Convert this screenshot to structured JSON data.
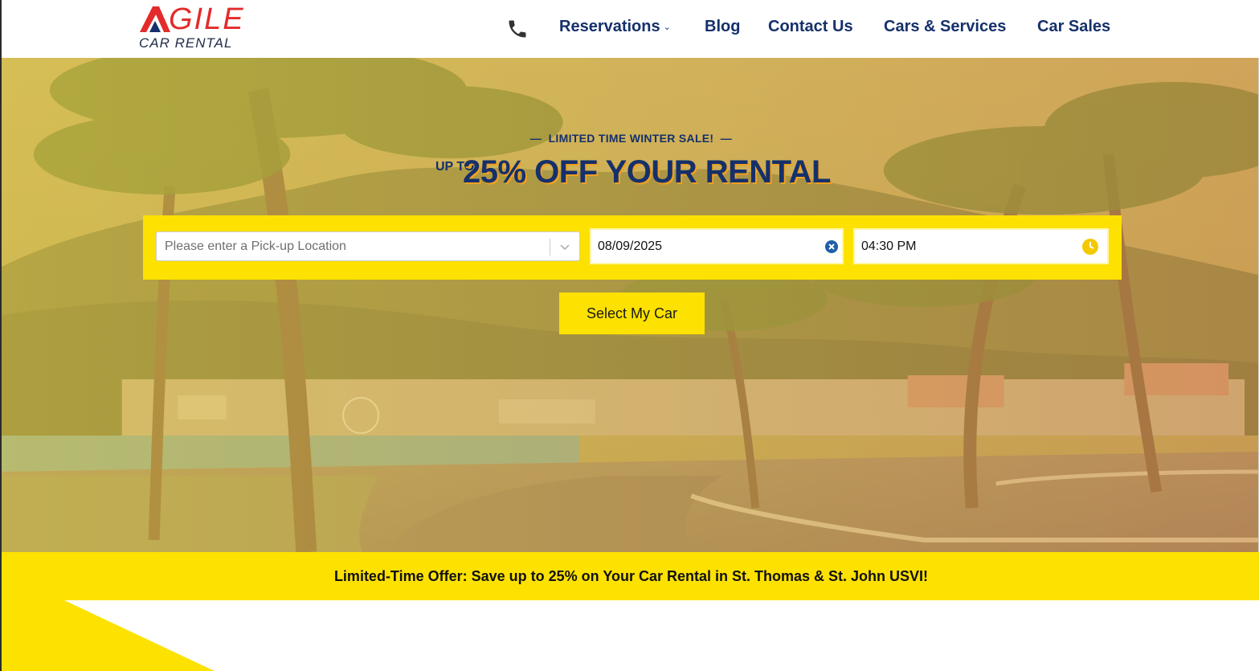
{
  "brand": {
    "logo_word": "GILE",
    "logo_sub": "CAR RENTAL",
    "logo_alt": "AGILE CAR RENTAL",
    "accent_red": "#e32b2b",
    "navy": "#15306b",
    "yellow": "#fde100"
  },
  "nav": {
    "phone_icon": "phone-icon",
    "items": [
      {
        "label": "Reservations",
        "has_dropdown": true
      },
      {
        "label": "Blog"
      },
      {
        "label": "Contact Us"
      },
      {
        "label": "Cars & Services"
      },
      {
        "label": "Car Sales"
      }
    ]
  },
  "hero": {
    "eyebrow": "LIMITED TIME WINTER SALE!",
    "eyebrow_dashes": "—",
    "upto": "UP TO",
    "headline": "25% OFF YOUR RENTAL"
  },
  "search": {
    "location_placeholder": "Please enter a Pick-up Location",
    "date_value": "08/09/2025",
    "time_value": "04:30 PM",
    "submit_label": "Select My Car"
  },
  "offer": {
    "text": "Limited-Time Offer: Save up to 25% on Your Car Rental in St. Thomas & St. John USVI!"
  }
}
